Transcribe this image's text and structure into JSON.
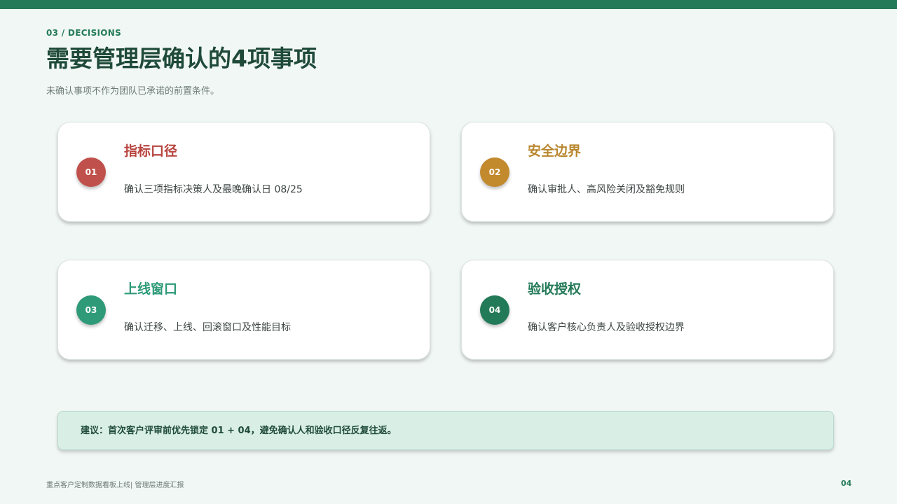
{
  "header": {
    "section_label": "03 / DECISIONS",
    "title": "需要管理层确认的4项事项",
    "subtitle": "未确认事项不作为团队已承诺的前置条件。"
  },
  "cards": [
    {
      "number": "01",
      "title": "指标口径",
      "description": "确认三项指标决策人及最晚确认日 08/25",
      "color": "#c0504b"
    },
    {
      "number": "02",
      "title": "安全边界",
      "description": "确认审批人、高风险关闭及豁免规则",
      "color": "#c2892d"
    },
    {
      "number": "03",
      "title": "上线窗口",
      "description": "确认迁移、上线、回滚窗口及性能目标",
      "color": "#2e9a78"
    },
    {
      "number": "04",
      "title": "验收授权",
      "description": "确认客户核心负责人及验收授权边界",
      "color": "#237a58"
    }
  ],
  "suggestion": {
    "text": "建议：首次客户评审前优先锁定 01 + 04，避免确认人和验收口径反复往返。"
  },
  "footer": {
    "left_text": "重点客户定制数据看板上线| 管理层进度汇报",
    "page_number": "04"
  },
  "colors": {
    "accent": "#237a58",
    "background": "#f1f7f5",
    "title": "#1f4a3a",
    "suggestion_bg": "#d9efe6"
  }
}
